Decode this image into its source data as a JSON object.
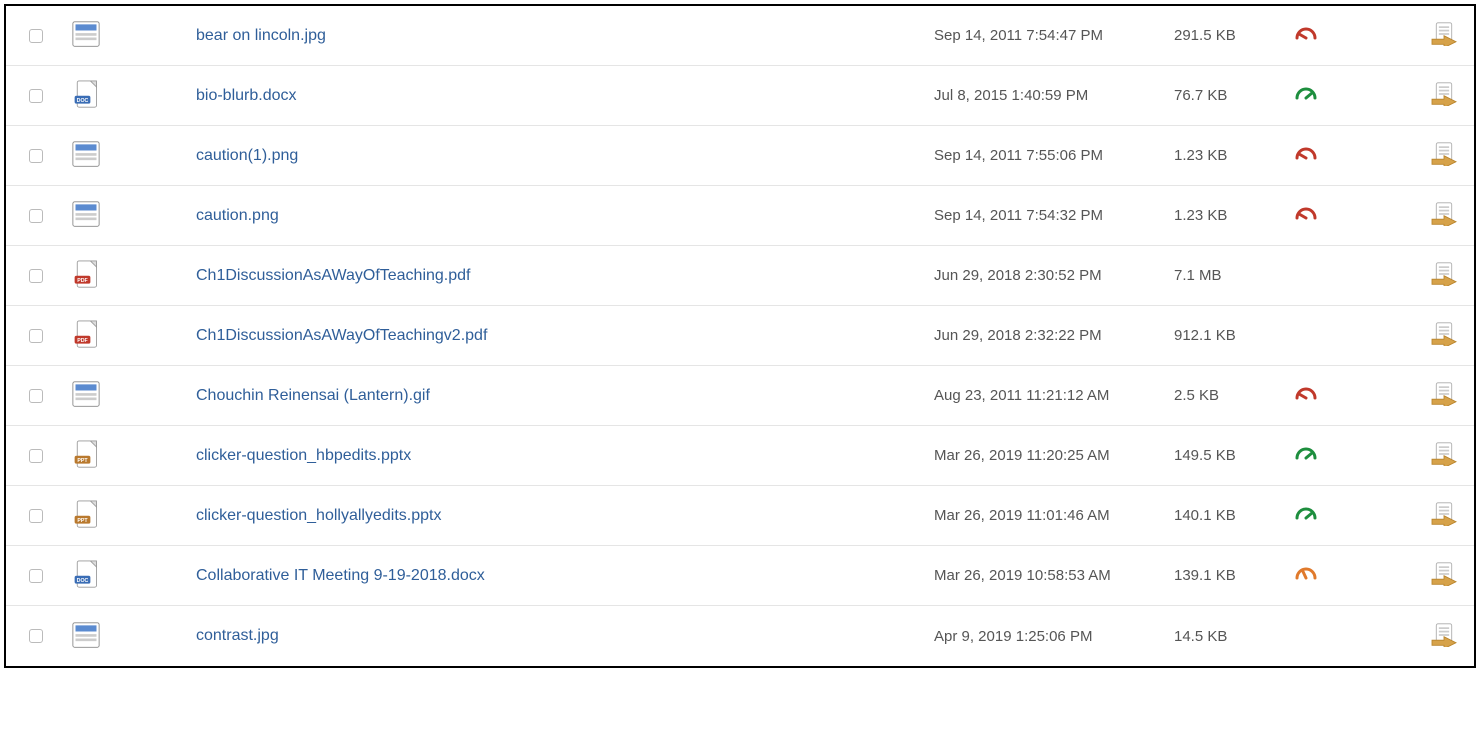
{
  "files": [
    {
      "name": "bear on lincoln.jpg",
      "type": "image",
      "modified": "Sep 14, 2011 7:54:47 PM",
      "size": "291.5 KB",
      "gauge": "red"
    },
    {
      "name": "bio-blurb.docx",
      "type": "docx",
      "modified": "Jul 8, 2015 1:40:59 PM",
      "size": "76.7 KB",
      "gauge": "green"
    },
    {
      "name": "caution(1).png",
      "type": "image",
      "modified": "Sep 14, 2011 7:55:06 PM",
      "size": "1.23 KB",
      "gauge": "red"
    },
    {
      "name": "caution.png",
      "type": "image",
      "modified": "Sep 14, 2011 7:54:32 PM",
      "size": "1.23 KB",
      "gauge": "red"
    },
    {
      "name": "Ch1DiscussionAsAWayOfTeaching.pdf",
      "type": "pdf",
      "modified": "Jun 29, 2018 2:30:52 PM",
      "size": "7.1 MB",
      "gauge": "none"
    },
    {
      "name": "Ch1DiscussionAsAWayOfTeachingv2.pdf",
      "type": "pdf",
      "modified": "Jun 29, 2018 2:32:22 PM",
      "size": "912.1 KB",
      "gauge": "none"
    },
    {
      "name": "Chouchin Reinensai (Lantern).gif",
      "type": "image",
      "modified": "Aug 23, 2011 11:21:12 AM",
      "size": "2.5 KB",
      "gauge": "red"
    },
    {
      "name": "clicker-question_hbpedits.pptx",
      "type": "pptx",
      "modified": "Mar 26, 2019 11:20:25 AM",
      "size": "149.5 KB",
      "gauge": "green"
    },
    {
      "name": "clicker-question_hollyallyedits.pptx",
      "type": "pptx",
      "modified": "Mar 26, 2019 11:01:46 AM",
      "size": "140.1 KB",
      "gauge": "green"
    },
    {
      "name": "Collaborative IT Meeting 9-19-2018.docx",
      "type": "docx",
      "modified": "Mar 26, 2019 10:58:53 AM",
      "size": "139.1 KB",
      "gauge": "orange"
    },
    {
      "name": "contrast.jpg",
      "type": "image",
      "modified": "Apr 9, 2019 1:25:06 PM",
      "size": "14.5 KB",
      "gauge": "none"
    }
  ],
  "colors": {
    "link": "#2f5e99",
    "gauge_red": "#c0392b",
    "gauge_green": "#1e8e3e",
    "gauge_orange": "#e07a2c"
  }
}
